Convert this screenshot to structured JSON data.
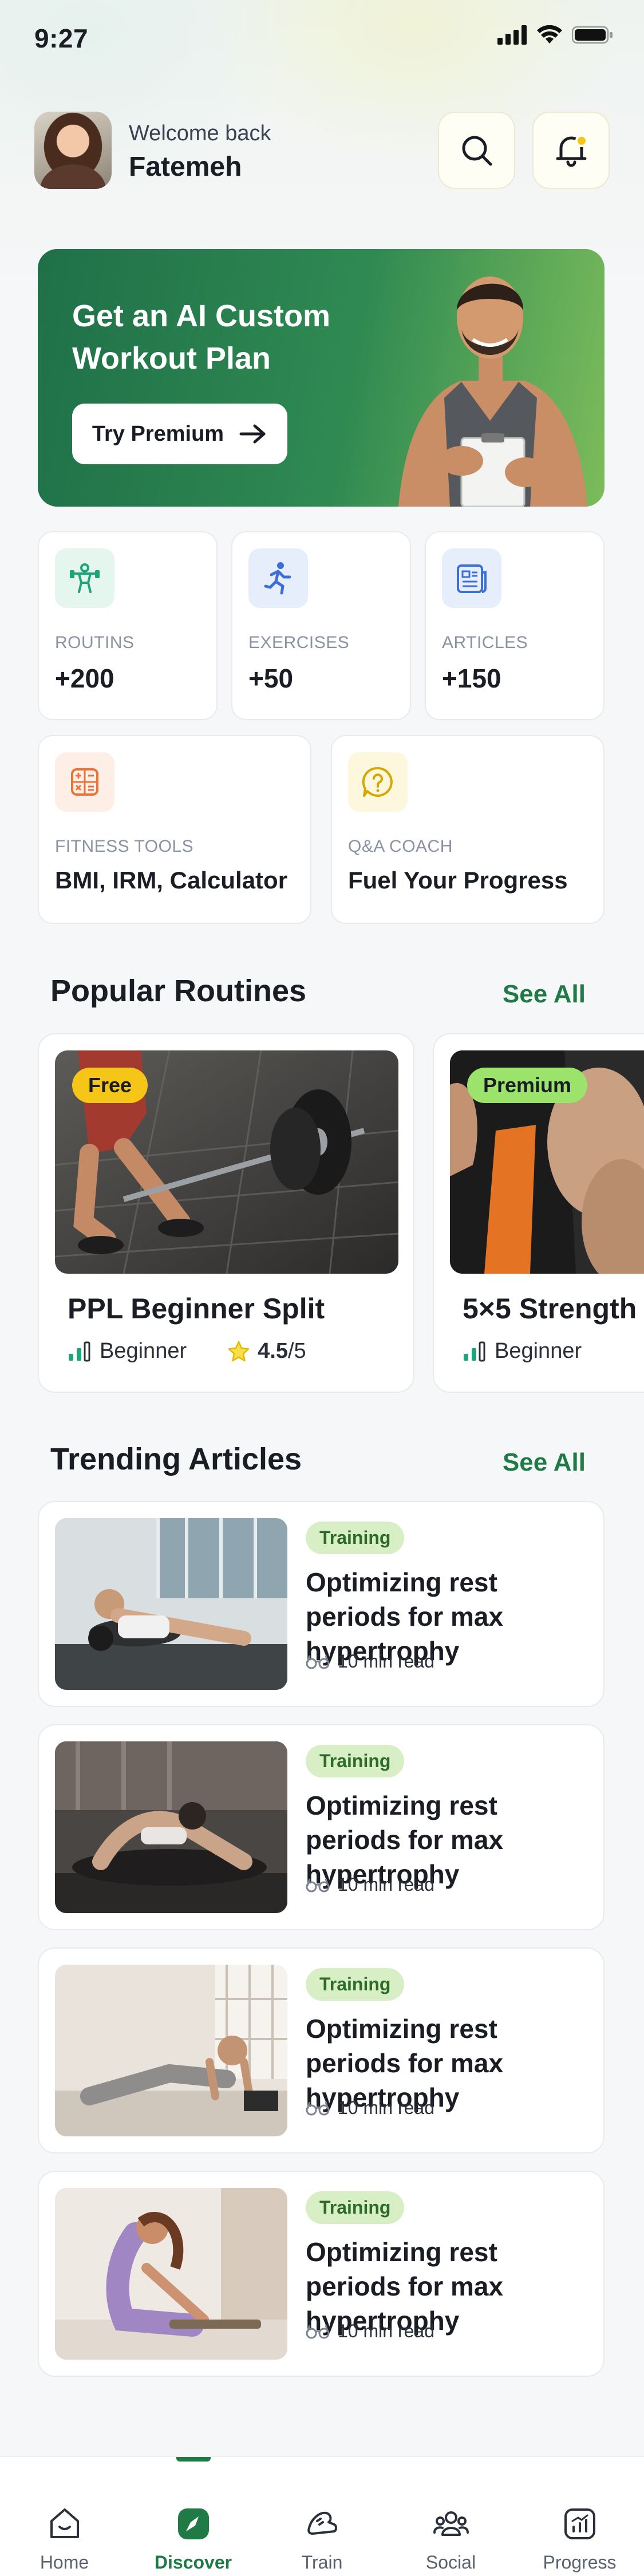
{
  "status": {
    "time": "9:27"
  },
  "header": {
    "welcome": "Welcome back",
    "username": "Fatemeh"
  },
  "promo": {
    "title": "Get an AI Custom Workout Plan",
    "button_label": "Try Premium"
  },
  "stats": [
    {
      "label": "ROUTINS",
      "value": "+200",
      "icon": "dumbbell-person-icon",
      "bg": "#e5f6ef",
      "color": "#1fa37a"
    },
    {
      "label": "EXERCISES",
      "value": "+50",
      "icon": "running-icon",
      "bg": "#e6eefb",
      "color": "#3d6fd8"
    },
    {
      "label": "ARTICLES",
      "value": "+150",
      "icon": "article-icon",
      "bg": "#e6eefb",
      "color": "#3d6fd8"
    },
    {
      "label": "FITNESS TOOLS",
      "value": "BMI, IRM, Calculator",
      "icon": "calculator-icon",
      "bg": "#fdeee6",
      "color": "#e8743b"
    },
    {
      "label": "Q&A COACH",
      "value": "Fuel Your Progress",
      "icon": "question-bubble-icon",
      "bg": "#fdf7dd",
      "color": "#d4a800"
    }
  ],
  "routines": {
    "title": "Popular Routines",
    "see_all": "See All",
    "items": [
      {
        "badge": "Free",
        "badge_color": "#f5c518",
        "title": "PPL Beginner Split",
        "level": "Beginner",
        "rating": "4.5",
        "rating_max": "/5"
      },
      {
        "badge": "Premium",
        "badge_color": "#9be36a",
        "title": "5×5 Strength",
        "level": "Beginner"
      }
    ]
  },
  "articles": {
    "title": "Trending Articles",
    "see_all": "See All",
    "items": [
      {
        "tag": "Training",
        "title": "Optimizing rest periods for max hypertrophy",
        "read": "10 min read"
      },
      {
        "tag": "Training",
        "title": "Optimizing rest periods for max hypertrophy",
        "read": "10 min read"
      },
      {
        "tag": "Training",
        "title": "Optimizing rest periods for max hypertrophy",
        "read": "10 min read"
      },
      {
        "tag": "Training",
        "title": "Optimizing rest periods for max hypertrophy",
        "read": "10 min read"
      }
    ]
  },
  "tabbar": {
    "tabs": [
      {
        "label": "Home",
        "icon": "home-icon"
      },
      {
        "label": "Discover",
        "icon": "compass-icon",
        "active": true
      },
      {
        "label": "Train",
        "icon": "train-icon"
      },
      {
        "label": "Social",
        "icon": "people-icon"
      },
      {
        "label": "Progress",
        "icon": "chart-icon"
      }
    ]
  },
  "colors": {
    "brand": "#1f7a45",
    "accent_yellow": "#f5c518"
  }
}
